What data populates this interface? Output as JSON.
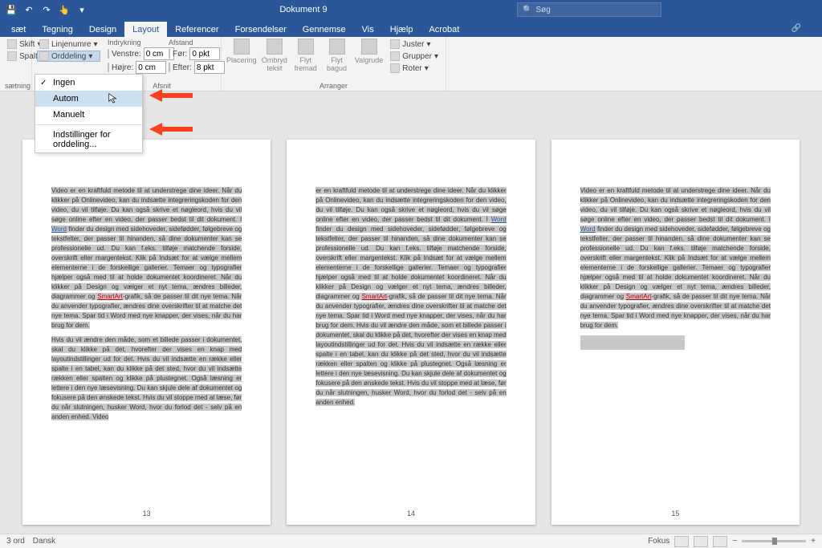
{
  "titlebar": {
    "doc_title": "Dokument 9",
    "search_placeholder": "Søg"
  },
  "tabs": [
    "sæt",
    "Tegning",
    "Design",
    "Layout",
    "Referencer",
    "Forsendelser",
    "Gennemse",
    "Vis",
    "Hjælp",
    "Acrobat"
  ],
  "active_tab": "Layout",
  "ribbon": {
    "group_setup": {
      "label": "sætning",
      "skift": "Skift",
      "spalter": "Spalter",
      "linjenumre": "Linjenumre",
      "orddeling": "Orddeling"
    },
    "group_indent": {
      "label": "Afsnit",
      "head_left": "Indrykning",
      "head_right": "Afstand",
      "venstre_lbl": "Venstre:",
      "venstre_val": "0 cm",
      "hojre_lbl": "Højre:",
      "hojre_val": "0 cm",
      "for_lbl": "Før:",
      "for_val": "0 pkt",
      "efter_lbl": "Efter:",
      "efter_val": "8 pkt"
    },
    "group_arrange": {
      "label": "Arranger",
      "placering": "Placering",
      "ombryd": "Ombryd tekst",
      "flyt_fremad": "Flyt fremad",
      "flyt_bagud": "Flyt bagud",
      "valgrude": "Valgrude",
      "juster": "Juster",
      "grupper": "Grupper",
      "roter": "Roter"
    }
  },
  "dropdown": {
    "ingen": "Ingen",
    "autom": "Autom",
    "manuelt": "Manuelt",
    "indstillinger": "Indstillinger for orddeling..."
  },
  "share_label": "Del",
  "pages": {
    "p1_num": "13",
    "p2_num": "14",
    "p3_num": "15",
    "body1a": "Video er en kraftfuld metode til at understrege dine ideer. Når du klikker på Onlinevideo, kan du indsætte integreringskoden for den video, du vil tilføje. Du kan også skrive et nøgleord, hvis du vil søge online efter en video, der passer bedst til dit dokument. I ",
    "word": "Word",
    "body1b": " finder du design med sidehoveder, sidefødder, følgebreve og tekstfelter, der passer til hinanden, så dine dokumenter kan se professionelle ud. Du kan f.eks. tilføje matchende forside, overskrift eller margentekst. Klik på Indsæt for at vælge mellem elementerne i de forskellige gallerier. Temaer og typografier hjælper også med til at holde dokumentet koordineret. Når du klikker på Design og vælger et nyt tema, ændres billeder, diagrammer og ",
    "smartart": "SmartArt",
    "body1c": "-grafik, så de passer til dit nye tema. Når du anvender typografier, ændres dine overskrifter til at matche det nye tema. Spar tid i Word med nye knapper, der vises, når du har brug for dem.",
    "body2": "Hvis du vil ændre den måde, som et billede passer i dokumentet, skal du klikke på det, hvorefter der vises en knap med layoutindstillinger ud for det. Hvis du vil indsætte en række eller spalte i en tabel, kan du klikke på det sted, hvor du vil indsætte rækken eller spalten og klikke på plustegnet. Også læsning er lettere i den nye læsevisning. Du kan skjule dele af dokumentet og fokusere på den ønskede tekst. Hvis du vil stoppe med at læse, før du når slutningen, husker Word, hvor du forlod det - selv på en anden enhed. Video",
    "body2_p2": "Hvis du vil ændre den måde, som et billede passer i dokumentet, skal du klikke på det, hvorefter der vises en knap med layoutindstillinger ud for det. Hvis du vil indsætte en række eller spalte i en tabel, kan du klikke på det sted, hvor du vil indsætte rækken eller spalten og klikke på plustegnet. Også læsning er lettere i den nye læsevisning. Du kan skjule dele af dokumentet og fokusere på den ønskede tekst. Hvis du vil stoppe med at læse, før du når slutningen, husker Word, hvor du forlod det - selv på en anden enhed.",
    "p2_lead": "er en kraftfuld metode til at understrege dine ideer. Når du klikker på Onlinevideo, kan du indsætte integreringskoden for den video, du vil tilføje. Du kan også skrive et nøgleord, hvis du vil søge online efter en video, der passer bedst til dit dokument. I "
  },
  "status": {
    "words": "3 ord",
    "lang": "Dansk",
    "focus": "Fokus"
  }
}
